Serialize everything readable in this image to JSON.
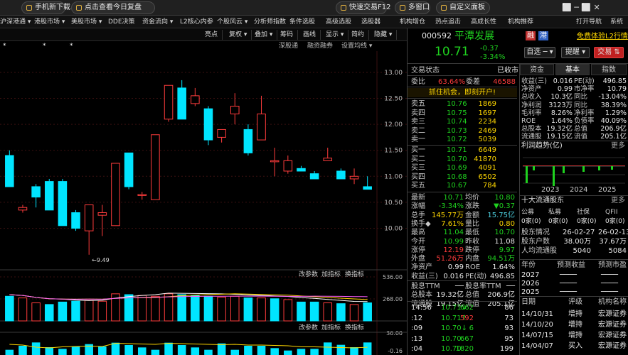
{
  "topbar": {
    "download": "手机新下载",
    "review": "点击查看今日复盘",
    "quick_trade": "快速交易F12",
    "multi_window": "多窗口",
    "custom_panel": "自定义面板",
    "win_controls": "⬜ ─ ⬜ ✕"
  },
  "menubar": {
    "items": [
      "沪深港通 ▾",
      "港股市场 ▾",
      "美股市场 ▾",
      "DDE决策",
      "资金流向 ▾",
      "L2核心内参",
      "个股风云 ▾",
      "分析师指数",
      "条件选股",
      "高级选股",
      "选股器",
      "机构增仓",
      "热点追击",
      "高成长性",
      "机构推荐",
      "打开导航",
      "系统"
    ]
  },
  "toolbar": {
    "items": [
      "亮点",
      "复权 ▾",
      "叠加 ▾",
      "筹码",
      "画线",
      "显示 ▾",
      "简约",
      "隐藏 ▾"
    ],
    "sub_items": [
      "深股通",
      "融资融券",
      "设置均线 ▾"
    ]
  },
  "chart_data": {
    "type": "candlestick",
    "ylim": [
      9.2,
      13.3
    ],
    "yticks": [
      13.0,
      12.5,
      12.0,
      11.5,
      11.0,
      10.5,
      10.0
    ],
    "candles": [
      {
        "o": 11.4,
        "h": 11.5,
        "l": 10.8,
        "c": 10.8
      },
      {
        "o": 10.35,
        "h": 10.45,
        "l": 10.3,
        "c": 10.4
      },
      {
        "o": 10.8,
        "h": 10.85,
        "l": 10.4,
        "c": 10.6
      },
      {
        "o": 10.9,
        "h": 10.95,
        "l": 10.35,
        "c": 10.35
      },
      {
        "o": 10.9,
        "h": 10.95,
        "l": 10.05,
        "c": 10.05
      },
      {
        "o": 10.3,
        "h": 10.35,
        "l": 9.95,
        "c": 10.0
      },
      {
        "o": 9.95,
        "h": 10.45,
        "l": 9.49,
        "c": 10.45
      },
      {
        "o": 10.25,
        "h": 10.45,
        "l": 9.85,
        "c": 10.3
      },
      {
        "o": 10.05,
        "h": 11.25,
        "l": 10.05,
        "c": 11.25
      },
      {
        "o": 11.45,
        "h": 11.45,
        "l": 10.75,
        "c": 10.8
      },
      {
        "o": 10.65,
        "h": 10.7,
        "l": 10.55,
        "c": 10.65
      },
      {
        "o": 10.55,
        "h": 11.8,
        "l": 10.55,
        "c": 11.8
      },
      {
        "o": 12.1,
        "h": 12.75,
        "l": 12.05,
        "c": 12.75
      },
      {
        "o": 12.7,
        "h": 12.85,
        "l": 12.1,
        "c": 12.1
      },
      {
        "o": 12.4,
        "h": 12.7,
        "l": 12.35,
        "c": 12.55
      },
      {
        "o": 12.3,
        "h": 12.35,
        "l": 11.6,
        "c": 11.7
      },
      {
        "o": 11.75,
        "h": 11.9,
        "l": 11.65,
        "c": 11.9
      },
      {
        "o": 12.2,
        "h": 12.6,
        "l": 12.0,
        "c": 12.35
      },
      {
        "o": 11.9,
        "h": 12.0,
        "l": 11.4,
        "c": 11.45
      },
      {
        "o": 11.7,
        "h": 12.55,
        "l": 11.7,
        "c": 12.2
      },
      {
        "o": 11.3,
        "h": 11.55,
        "l": 11.0,
        "c": 11.3
      },
      {
        "o": 11.1,
        "h": 11.4,
        "l": 11.05,
        "c": 11.3
      },
      {
        "o": 11.15,
        "h": 11.2,
        "l": 11.1,
        "c": 11.1
      },
      {
        "o": 11.05,
        "h": 11.1,
        "l": 10.95,
        "c": 10.95
      },
      {
        "o": 11.3,
        "h": 11.55,
        "l": 11.3,
        "c": 11.35
      },
      {
        "o": 11.1,
        "h": 11.15,
        "l": 10.95,
        "c": 10.95
      },
      {
        "o": 10.95,
        "h": 11.15,
        "l": 10.85,
        "c": 11.0
      },
      {
        "o": 10.8,
        "h": 11.0,
        "l": 10.75,
        "c": 10.75
      }
    ],
    "low_label": "←9.49",
    "volume": {
      "ticks": [
        "536.00",
        "268.00"
      ],
      "values": [
        300,
        280,
        220,
        200,
        230,
        240,
        250,
        240,
        330,
        320,
        310,
        300,
        330,
        320,
        310,
        300,
        290,
        300,
        280,
        280,
        270,
        260,
        230,
        230,
        220,
        210,
        200,
        220
      ],
      "up": [
        false,
        true,
        true,
        false,
        false,
        false,
        true,
        true,
        true,
        false,
        true,
        true,
        true,
        false,
        false,
        false,
        true,
        true,
        false,
        true,
        false,
        true,
        false,
        false,
        true,
        false,
        true,
        false
      ]
    },
    "ind_labels": [
      "改参数",
      "加指标",
      "换指标"
    ],
    "ind3_tick": "36.00",
    "ind3_tick2": "-0.16"
  },
  "stock": {
    "code": "000592",
    "name": "平潭发展",
    "badges": [
      "融",
      "港"
    ],
    "promo": "免费体验L2行情",
    "price": "10.71",
    "change": "-0.37",
    "pct": "-3.34%",
    "buttons": {
      "watch": "自选 ─ ▾",
      "alert": "提醒 ▾",
      "trade": "交易 ⇅"
    }
  },
  "quote": {
    "status_label": "交易状态",
    "status_value": "已收市",
    "wb_label": "委比",
    "wb_value": "63.64%",
    "wc_label": "委差",
    "wc_value": "46588",
    "ad": "抓住机会，即刻开户!",
    "asks": [
      {
        "label": "卖五",
        "price": "10.76",
        "vol": "1869"
      },
      {
        "label": "卖四",
        "price": "10.75",
        "vol": "1697"
      },
      {
        "label": "卖三",
        "price": "10.74",
        "vol": "2234"
      },
      {
        "label": "卖二",
        "price": "10.73",
        "vol": "2469"
      },
      {
        "label": "卖一",
        "price": "10.72",
        "vol": "5039"
      }
    ],
    "bids": [
      {
        "label": "买一",
        "price": "10.71",
        "vol": "6649"
      },
      {
        "label": "买二",
        "price": "10.70",
        "vol": "41870"
      },
      {
        "label": "买三",
        "price": "10.69",
        "vol": "4091"
      },
      {
        "label": "买四",
        "price": "10.68",
        "vol": "6502"
      },
      {
        "label": "买五",
        "price": "10.67",
        "vol": "784"
      }
    ],
    "stats": [
      {
        "l1": "最新",
        "v1": "10.71",
        "c1": "green",
        "l2": "均价",
        "v2": "10.80",
        "c2": "green"
      },
      {
        "l1": "涨幅",
        "v1": "-3.34%",
        "c1": "green",
        "l2": "涨跌",
        "v2": "▼0.37",
        "c2": "green"
      },
      {
        "l1": "总手",
        "v1": "145.77万",
        "c1": "yellow",
        "l2": "金额",
        "v2": "15.75亿",
        "c2": "cyan"
      },
      {
        "l1": "换手◆",
        "v1": "7.61%",
        "c1": "yellow",
        "l2": "量比",
        "v2": "0.80",
        "c2": "yellow"
      },
      {
        "l1": "最高",
        "v1": "11.04",
        "c1": "green",
        "l2": "最低",
        "v2": "10.70",
        "c2": "green"
      },
      {
        "l1": "今开",
        "v1": "10.99",
        "c1": "green",
        "l2": "昨收",
        "v2": "11.08",
        "c2": "white"
      },
      {
        "l1": "涨停",
        "v1": "12.19",
        "c1": "red",
        "l2": "跌停",
        "v2": "9.97",
        "c2": "green"
      },
      {
        "l1": "外盘",
        "v1": "51.26万",
        "c1": "red",
        "l2": "内盘",
        "v2": "94.51万",
        "c2": "green"
      },
      {
        "l1": "净资产",
        "v1": "0.99",
        "c1": "white",
        "l2": "ROE",
        "v2": "1.64%",
        "c2": "white"
      },
      {
        "l1": "收益(三)",
        "v1": "0.016",
        "c1": "white",
        "l2": "PE(动)",
        "v2": "496.85",
        "c2": "white"
      },
      {
        "l1": "股息TTM",
        "v1": "──",
        "c1": "white",
        "l2": "股息率TTM",
        "v2": "──",
        "c2": "white"
      },
      {
        "l1": "总股本",
        "v1": "19.32亿",
        "c1": "white",
        "l2": "总值",
        "v2": "206.9亿",
        "c2": "white"
      },
      {
        "l1": "流通股",
        "v1": "19.15亿",
        "c1": "white",
        "l2": "流值",
        "v2": "205.1亿",
        "c2": "white"
      }
    ],
    "ticks": [
      {
        "time": "14:56",
        "price": "10.71",
        "arrow": "↓",
        "vol": "662",
        "num": "86",
        "vc": "green"
      },
      {
        "time": ":12",
        "price": "10.71",
        "arrow": "↑",
        "vol": "592",
        "num": "73",
        "vc": "red"
      },
      {
        "time": ":09",
        "price": "10.70",
        "arrow": "↓",
        "vol": "6",
        "num": "93",
        "vc": "green"
      },
      {
        "time": ":13",
        "price": "10.70",
        "arrow": "",
        "vol": "667",
        "num": "95",
        "vc": "green"
      },
      {
        "time": ":04",
        "price": "10.70",
        "arrow": "",
        "vol": "1820",
        "num": "199",
        "vc": "green"
      }
    ]
  },
  "f10": {
    "tabs": [
      "资金",
      "基本",
      "指数"
    ],
    "rows": [
      {
        "a": "收益(三)",
        "b": "0.016",
        "c": "PE(动)",
        "d": "496.85"
      },
      {
        "a": "净资产",
        "b": "0.99",
        "c": "市净率",
        "d": "10.79"
      },
      {
        "a": "总收入",
        "b": "10.3亿",
        "c": "同比",
        "d": "-13.04%"
      },
      {
        "a": "净利润",
        "b": "3123万",
        "c": "同比",
        "d": "38.39%"
      },
      {
        "a": "毛利率",
        "b": "8.26%",
        "c": "净利率",
        "d": "1.29%"
      },
      {
        "a": "ROE",
        "b": "1.64%",
        "c": "负债率",
        "d": "40.09%"
      },
      {
        "a": "总股本",
        "b": "19.32亿",
        "c": "总值",
        "d": "206.9亿"
      },
      {
        "a": "流通股",
        "b": "19.15亿",
        "c": "流值",
        "d": "205.1亿"
      }
    ],
    "profit_title": "利润趋势(亿)",
    "more": "更多",
    "years": [
      "2023",
      "2024",
      "2025"
    ],
    "holders_title": "十大流通股东",
    "holder_cols": [
      "公募",
      "私募",
      "社保",
      "QFII"
    ],
    "holder_vals": [
      "0家(0)",
      "0家(0)",
      "0家(0)",
      "0家(0)"
    ],
    "holder_rows": [
      {
        "l": "股东情况",
        "a": "26-02-27",
        "b": "26-02-13"
      },
      {
        "l": "股东户数",
        "a": "38.00万",
        "b": "37.67万"
      },
      {
        "l": "人均流通股",
        "a": "5040",
        "b": "5084"
      }
    ],
    "forecast_header": [
      "年份",
      "预测收益",
      "预测市盈"
    ],
    "forecast_rows": [
      {
        "y": "2027",
        "a": "────",
        "b": "────"
      },
      {
        "y": "2026",
        "a": "────",
        "b": "────"
      },
      {
        "y": "2025",
        "a": "────",
        "b": "────"
      }
    ],
    "rating_header": [
      "日期",
      "评级",
      "机构名称"
    ],
    "rating_rows": [
      {
        "d": "14/10/31",
        "r": "增持",
        "o": "宏源证券"
      },
      {
        "d": "14/10/20",
        "r": "增持",
        "o": "宏源证券"
      },
      {
        "d": "14/07/15",
        "r": "增持",
        "o": "宏源证券"
      },
      {
        "d": "14/04/07",
        "r": "买入",
        "o": "宏源证券"
      }
    ]
  }
}
